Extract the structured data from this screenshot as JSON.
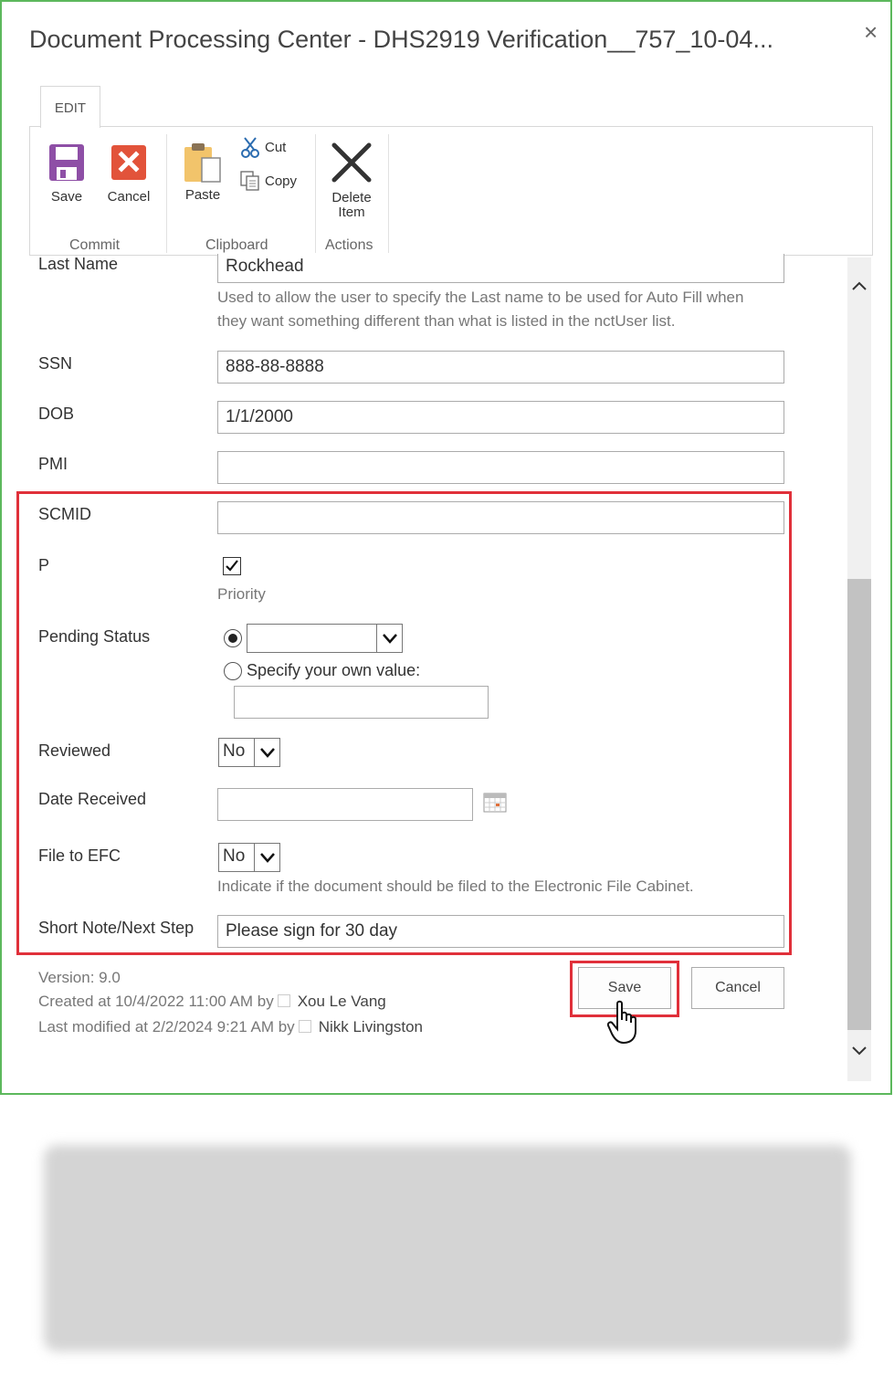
{
  "dialog": {
    "title": "Document Processing Center - DHS2919 Verification__757_10-04...",
    "close_glyph": "×"
  },
  "ribbon": {
    "tab_label": "EDIT",
    "groups": {
      "commit": {
        "label": "Commit",
        "save": "Save",
        "cancel": "Cancel"
      },
      "clipboard": {
        "label": "Clipboard",
        "paste": "Paste",
        "cut": "Cut",
        "copy": "Copy"
      },
      "actions": {
        "label": "Actions",
        "delete_line1": "Delete",
        "delete_line2": "Item"
      }
    }
  },
  "form": {
    "last_name": {
      "label": "Last Name",
      "value": "Rockhead",
      "help_line1": "Used to allow the user to specify the Last name to be used for Auto Fill when",
      "help_line2": "they want something different than what is listed in the nctUser list."
    },
    "ssn": {
      "label": "SSN",
      "value": "888-88-8888"
    },
    "dob": {
      "label": "DOB",
      "value": "1/1/2000"
    },
    "pmi": {
      "label": "PMI",
      "value": ""
    },
    "scmid": {
      "label": "SCMID",
      "value": ""
    },
    "p": {
      "label": "P",
      "checked": true,
      "checkbox_label": "Priority"
    },
    "pending_status": {
      "label": "Pending Status",
      "selected_value": "",
      "specify_label": "Specify your own value:",
      "specify_value": ""
    },
    "reviewed": {
      "label": "Reviewed",
      "value": "No"
    },
    "date_received": {
      "label": "Date Received",
      "value": ""
    },
    "file_to_efc": {
      "label": "File to EFC",
      "value": "No",
      "help": "Indicate if the document should be filed to the Electronic File Cabinet."
    },
    "short_note": {
      "label": "Short Note/Next Step",
      "value": "Please sign for 30 day"
    }
  },
  "footer": {
    "version": "Version: 9.0",
    "created_prefix": "Created at 10/4/2022 11:00 AM  by",
    "created_by": "Xou Le Vang",
    "modified_prefix": "Last modified at 2/2/2024 9:21 AM  by",
    "modified_by": "Nikk Livingston",
    "save_label": "Save",
    "cancel_label": "Cancel"
  },
  "colors": {
    "highlight": "#e0303a",
    "dialog_border": "#5cb85c",
    "save_icon": "#8e4fa6",
    "cancel_icon": "#e2533a"
  }
}
